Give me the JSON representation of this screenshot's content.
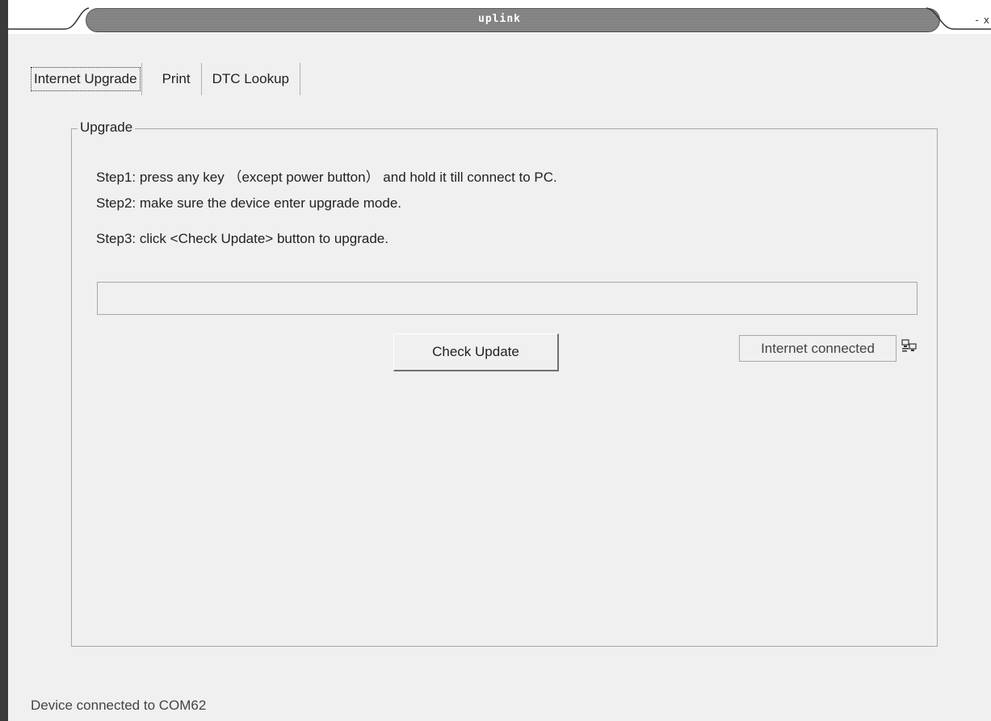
{
  "window": {
    "title": "uplink",
    "minimize_glyph": "-",
    "close_glyph": "x"
  },
  "tabs": [
    {
      "label": "Internet Upgrade",
      "active": true
    },
    {
      "label": "Print",
      "active": false
    },
    {
      "label": "DTC Lookup",
      "active": false
    }
  ],
  "upgrade": {
    "group_title": "Upgrade",
    "steps": [
      "Step1: press any key （except power button） and hold it till connect to PC.",
      "Step2: make sure the device enter upgrade mode.",
      "Step3: click <Check Update> button to upgrade."
    ],
    "progress": 0,
    "check_button_label": "Check Update",
    "internet_status": "Internet connected",
    "network_icon": "network-computers-icon"
  },
  "statusbar": {
    "text": "Device connected to COM62"
  }
}
